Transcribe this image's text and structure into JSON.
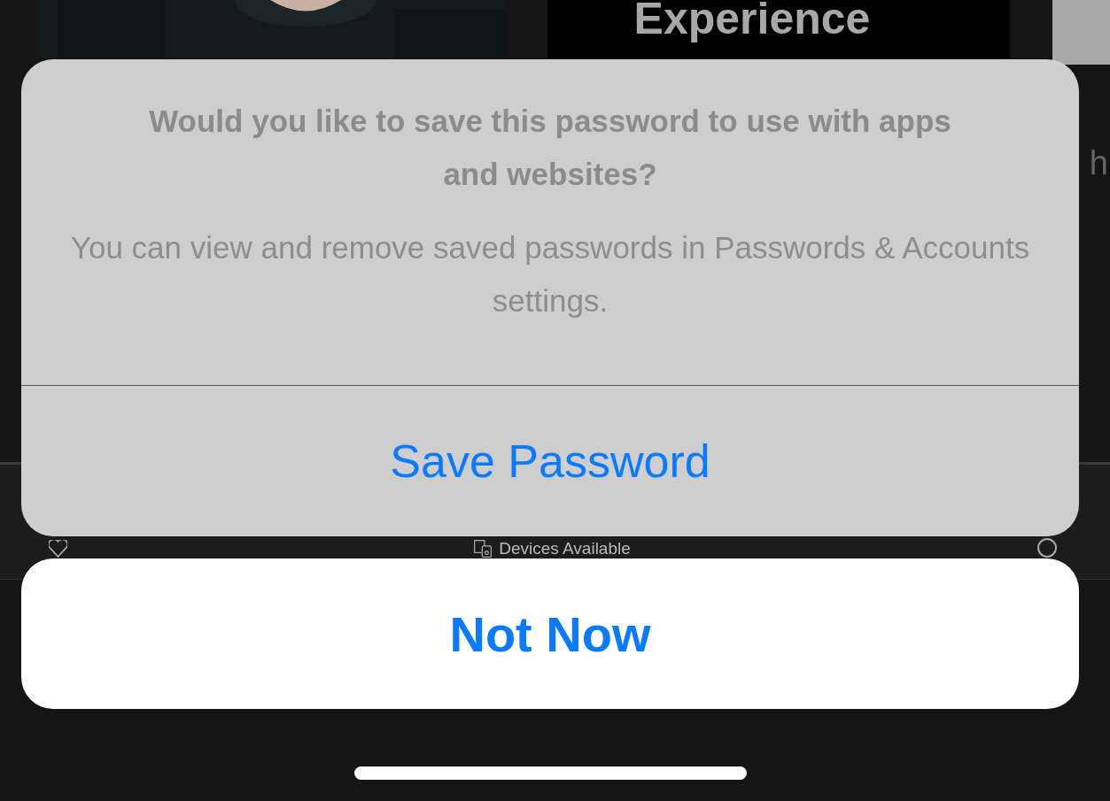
{
  "background": {
    "banner_text": "Experience",
    "side_text": "h",
    "devices_label": "Devices Available"
  },
  "alert": {
    "title": "Would you like to save this password to use with apps and websites?",
    "message": "You can view and remove saved passwords in Passwords & Accounts settings.",
    "action": "Save Password"
  },
  "cancel": "Not Now"
}
